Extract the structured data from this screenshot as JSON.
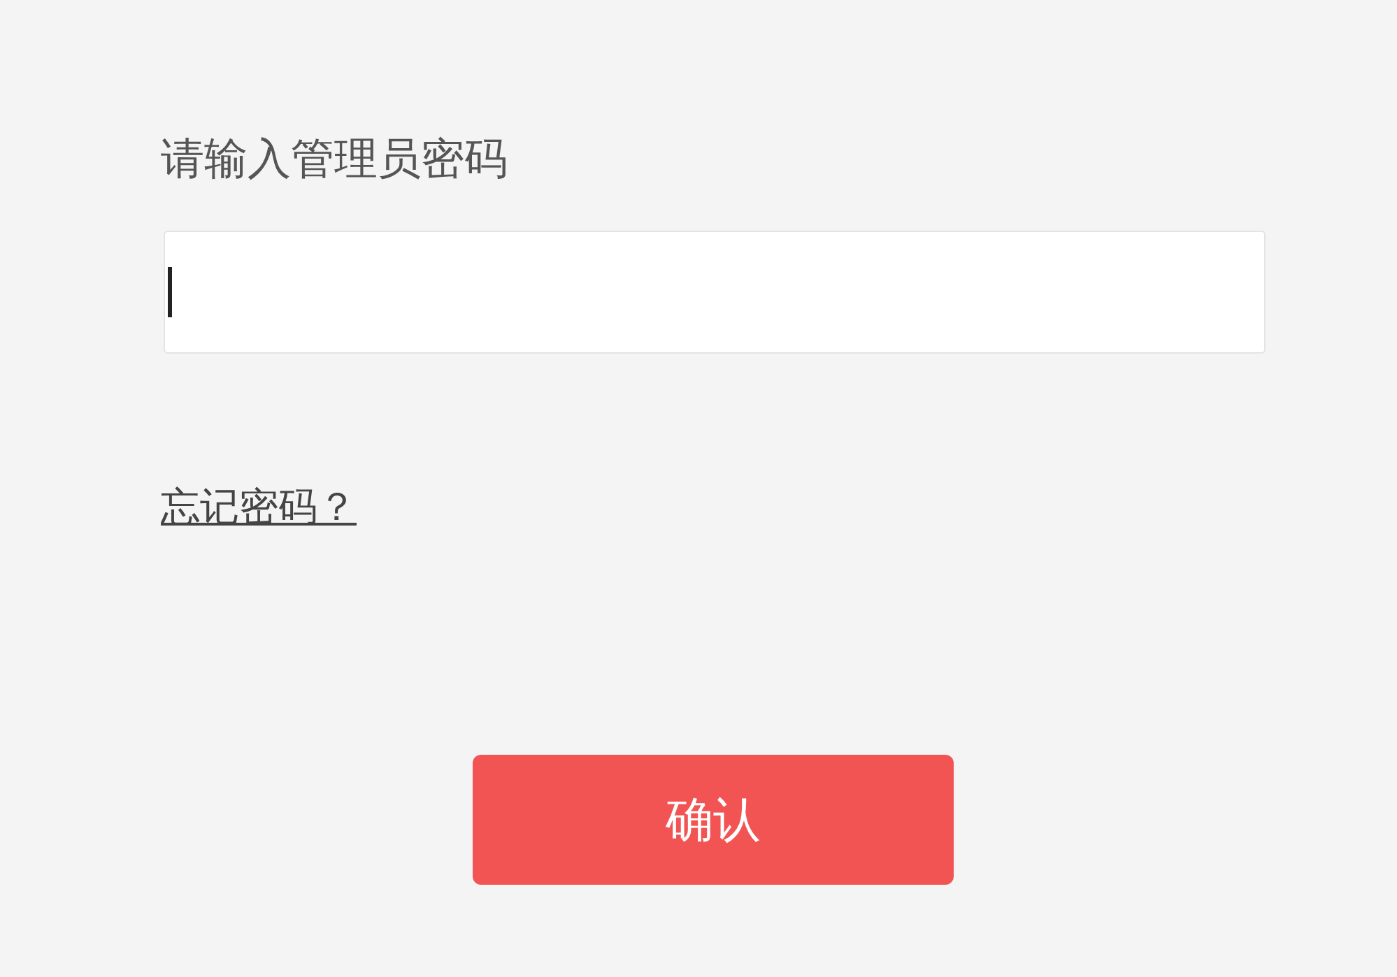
{
  "prompt": "请输入管理员密码",
  "password_field": {
    "focused": true
  },
  "forgot_link": "忘记密码？",
  "confirm_button": "确认"
}
